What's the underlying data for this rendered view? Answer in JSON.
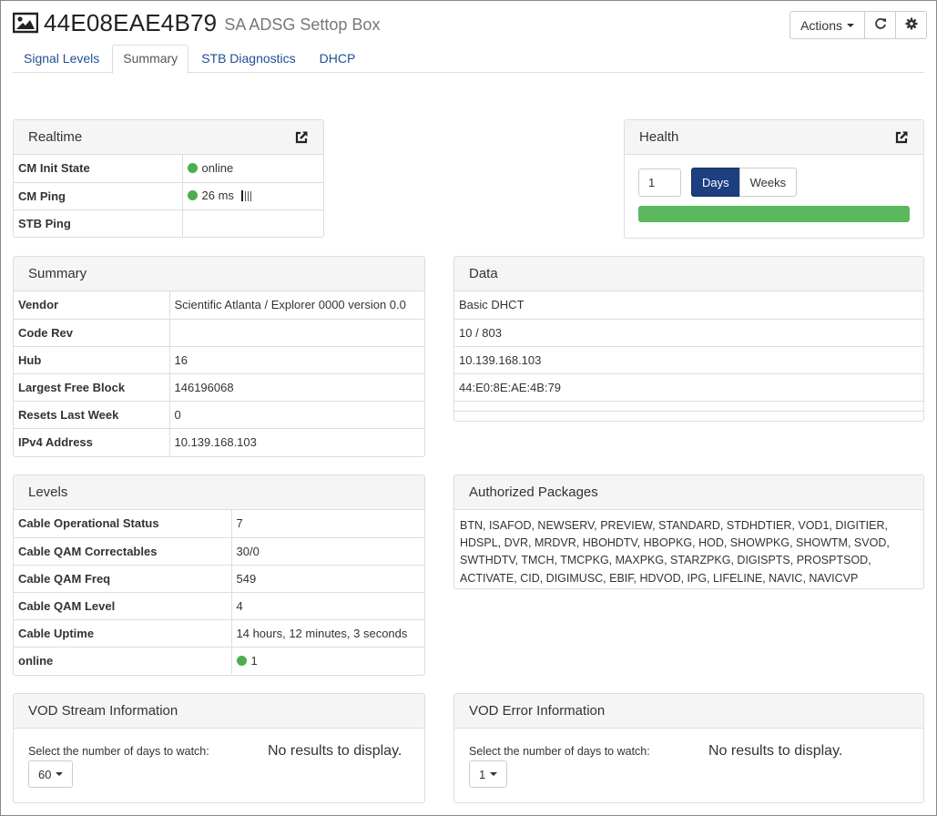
{
  "header": {
    "device_id": "44E08EAE4B79",
    "device_type": "SA ADSG Settop Box",
    "actions_label": "Actions"
  },
  "icons": {
    "device": "image-icon",
    "refresh": "refresh-icon",
    "settings": "gear-icon",
    "external": "external-link-icon",
    "dropdown": "caret-down-icon",
    "signal": "signal-bars-icon"
  },
  "colors": {
    "accent": "#1b3f7f",
    "link": "#1f4e96",
    "status_ok": "#4cae4c",
    "health_bar": "#5cb85c"
  },
  "tabs": [
    {
      "label": "Signal Levels",
      "active": false
    },
    {
      "label": "Summary",
      "active": true
    },
    {
      "label": "STB Diagnostics",
      "active": false
    },
    {
      "label": "DHCP",
      "active": false
    }
  ],
  "realtime": {
    "title": "Realtime",
    "rows": [
      {
        "key": "CM Init State",
        "value": "online",
        "status": "ok"
      },
      {
        "key": "CM Ping",
        "value": "26 ms",
        "status": "ok",
        "signal": true
      },
      {
        "key": "STB Ping",
        "value": ""
      }
    ]
  },
  "health": {
    "title": "Health",
    "count": "1",
    "unit_days": "Days",
    "unit_weeks": "Weeks",
    "selected_unit": "Days",
    "health_level": 1.0
  },
  "summary": {
    "title": "Summary",
    "rows": [
      {
        "key": "Vendor",
        "value": "Scientific Atlanta / Explorer 0000 version 0.0"
      },
      {
        "key": "Code Rev",
        "value": ""
      },
      {
        "key": "Hub",
        "value": "16"
      },
      {
        "key": "Largest Free Block",
        "value": "146196068"
      },
      {
        "key": "Resets Last Week",
        "value": "0"
      },
      {
        "key": "IPv4 Address",
        "value": "10.139.168.103"
      }
    ]
  },
  "data_panel": {
    "title": "Data",
    "rows": [
      "Basic DHCT",
      "10 / 803",
      "10.139.168.103",
      "44:E0:8E:AE:4B:79",
      ""
    ]
  },
  "levels": {
    "title": "Levels",
    "rows": [
      {
        "key": "Cable Operational Status",
        "value": "7"
      },
      {
        "key": "Cable QAM Correctables",
        "value": "30/0"
      },
      {
        "key": "Cable QAM Freq",
        "value": "549"
      },
      {
        "key": "Cable QAM Level",
        "value": "4"
      },
      {
        "key": "Cable Uptime",
        "value": "14 hours, 12 minutes, 3 seconds"
      },
      {
        "key": "online",
        "value": "1",
        "status": "ok"
      }
    ]
  },
  "authorized_packages": {
    "title": "Authorized Packages",
    "text": "BTN, ISAFOD, NEWSERV, PREVIEW, STANDARD, STDHDTIER, VOD1, DIGITIER, HDSPL, DVR, MRDVR, HBOHDTV, HBOPKG, HOD, SHOWPKG, SHOWTM, SVOD, SWTHDTV, TMCH, TMCPKG, MAXPKG, STARZPKG, DIGISPTS, PROSPTSOD, ACTIVATE, CID, DIGIMUSC, EBIF, HDVOD, IPG, LIFELINE, NAVIC, NAVICVP"
  },
  "vod_stream": {
    "title": "VOD Stream Information",
    "select_label": "Select the number of days to watch:",
    "days_value": "60",
    "empty_text": "No results to display."
  },
  "vod_error": {
    "title": "VOD Error Information",
    "select_label": "Select the number of days to watch:",
    "days_value": "1",
    "empty_text": "No results to display."
  }
}
